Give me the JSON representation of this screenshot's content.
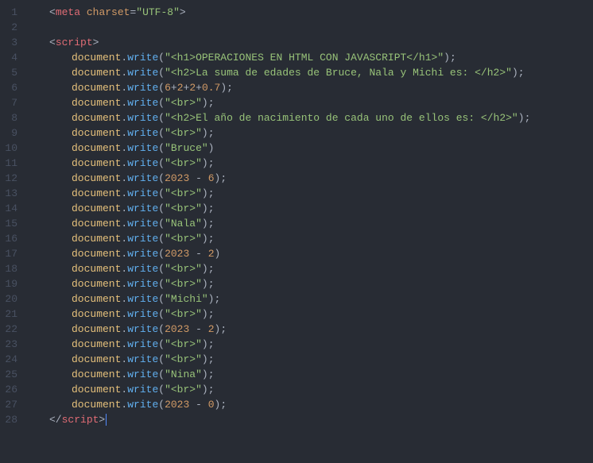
{
  "lines": [
    {
      "n": 1,
      "indent": 1,
      "type": "meta",
      "tag": "meta",
      "attr": "charset",
      "op": "=",
      "val": "\"UTF-8\""
    },
    {
      "n": 2,
      "indent": 0,
      "type": "blank"
    },
    {
      "n": 3,
      "indent": 1,
      "type": "open",
      "tag": "script"
    },
    {
      "n": 4,
      "indent": 2,
      "type": "call",
      "arg_kind": "str",
      "arg": "\"<h1>OPERACIONES EN HTML CON JAVASCRIPT</h1>\"",
      "semi": true
    },
    {
      "n": 5,
      "indent": 2,
      "type": "call",
      "arg_kind": "str",
      "arg": "\"<h2>La suma de edades de Bruce, Nala y Michi es: </h2>\"",
      "semi": true
    },
    {
      "n": 6,
      "indent": 2,
      "type": "call",
      "arg_kind": "expr",
      "parts": [
        "6",
        "+",
        "2",
        "+",
        "2",
        "+",
        "0.7"
      ],
      "semi": true
    },
    {
      "n": 7,
      "indent": 2,
      "type": "call",
      "arg_kind": "str",
      "arg": "\"<br>\"",
      "semi": true
    },
    {
      "n": 8,
      "indent": 2,
      "type": "call",
      "arg_kind": "str",
      "arg": "\"<h2>El año de nacimiento de cada uno de ellos es: </h2>\"",
      "semi": true
    },
    {
      "n": 9,
      "indent": 2,
      "type": "call",
      "arg_kind": "str",
      "arg": "\"<br>\"",
      "semi": true
    },
    {
      "n": 10,
      "indent": 2,
      "type": "call",
      "arg_kind": "str",
      "arg": "\"Bruce\"",
      "semi": false
    },
    {
      "n": 11,
      "indent": 2,
      "type": "call",
      "arg_kind": "str",
      "arg": "\"<br>\"",
      "semi": true
    },
    {
      "n": 12,
      "indent": 2,
      "type": "call",
      "arg_kind": "expr",
      "parts": [
        "2023",
        " - ",
        "6"
      ],
      "semi": true
    },
    {
      "n": 13,
      "indent": 2,
      "type": "call",
      "arg_kind": "str",
      "arg": "\"<br>\"",
      "semi": true
    },
    {
      "n": 14,
      "indent": 2,
      "type": "call",
      "arg_kind": "str",
      "arg": "\"<br>\"",
      "semi": true
    },
    {
      "n": 15,
      "indent": 2,
      "type": "call",
      "arg_kind": "str",
      "arg": "\"Nala\"",
      "semi": true
    },
    {
      "n": 16,
      "indent": 2,
      "type": "call",
      "arg_kind": "str",
      "arg": "\"<br>\"",
      "semi": true
    },
    {
      "n": 17,
      "indent": 2,
      "type": "call",
      "arg_kind": "expr",
      "parts": [
        "2023",
        " - ",
        "2"
      ],
      "semi": false
    },
    {
      "n": 18,
      "indent": 2,
      "type": "call",
      "arg_kind": "str",
      "arg": "\"<br>\"",
      "semi": true
    },
    {
      "n": 19,
      "indent": 2,
      "type": "call",
      "arg_kind": "str",
      "arg": "\"<br>\"",
      "semi": true
    },
    {
      "n": 20,
      "indent": 2,
      "type": "call",
      "arg_kind": "str",
      "arg": "\"Michi\"",
      "semi": true
    },
    {
      "n": 21,
      "indent": 2,
      "type": "call",
      "arg_kind": "str",
      "arg": "\"<br>\"",
      "semi": true
    },
    {
      "n": 22,
      "indent": 2,
      "type": "call",
      "arg_kind": "expr",
      "parts": [
        "2023",
        " - ",
        "2"
      ],
      "semi": true
    },
    {
      "n": 23,
      "indent": 2,
      "type": "call",
      "arg_kind": "str",
      "arg": "\"<br>\"",
      "semi": true
    },
    {
      "n": 24,
      "indent": 2,
      "type": "call",
      "arg_kind": "str",
      "arg": "\"<br>\"",
      "semi": true
    },
    {
      "n": 25,
      "indent": 2,
      "type": "call",
      "arg_kind": "str",
      "arg": "\"Nina\"",
      "semi": true
    },
    {
      "n": 26,
      "indent": 2,
      "type": "call",
      "arg_kind": "str",
      "arg": "\"<br>\"",
      "semi": true
    },
    {
      "n": 27,
      "indent": 2,
      "type": "call",
      "arg_kind": "expr",
      "parts": [
        "2023",
        " - ",
        "0"
      ],
      "semi": true
    },
    {
      "n": 28,
      "indent": 1,
      "type": "close",
      "tag": "script",
      "caret": true
    }
  ],
  "tokens": {
    "obj": "document",
    "dot": ".",
    "meth": "write",
    "lp": "(",
    "rp": ")",
    "semi": ";",
    "lt": "<",
    "gt": ">",
    "slash": "/"
  }
}
